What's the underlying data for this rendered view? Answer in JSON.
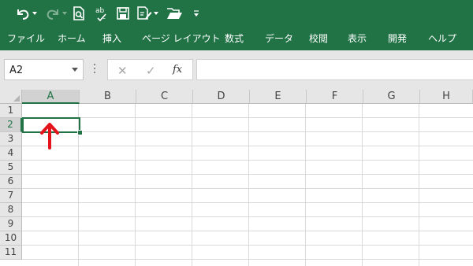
{
  "ribbon": {
    "background": "#217346",
    "quick_access": [
      {
        "icon": "undo-icon",
        "label": ""
      },
      {
        "icon": "redo-icon",
        "label": ""
      },
      {
        "icon": "print-preview-icon",
        "label": ""
      },
      {
        "icon": "spelling-icon",
        "label": ""
      },
      {
        "icon": "save-icon",
        "label": ""
      },
      {
        "icon": "form-icon",
        "label": ""
      },
      {
        "icon": "open-folder-icon",
        "label": ""
      },
      {
        "icon": "customize-qat-icon",
        "label": ""
      }
    ],
    "tabs": [
      "ファイル",
      "ホーム",
      "挿入",
      "ページ レイアウト",
      "数式",
      "データ",
      "校閲",
      "表示",
      "開発",
      "ヘルプ"
    ]
  },
  "formula_bar": {
    "name_box": "A2",
    "cancel_symbol": "✕",
    "enter_symbol": "✓",
    "fx_label": "fx",
    "formula": ""
  },
  "sheet": {
    "columns": [
      "A",
      "B",
      "C",
      "D",
      "E",
      "F",
      "G",
      "H"
    ],
    "rows": [
      "1",
      "2",
      "3",
      "4",
      "5",
      "6",
      "7",
      "8",
      "9",
      "10",
      "11"
    ],
    "selected_cell": "A2",
    "selected_column": "A",
    "selected_row": "2",
    "accent": "#217346",
    "annotation_color": "#e3141c"
  }
}
